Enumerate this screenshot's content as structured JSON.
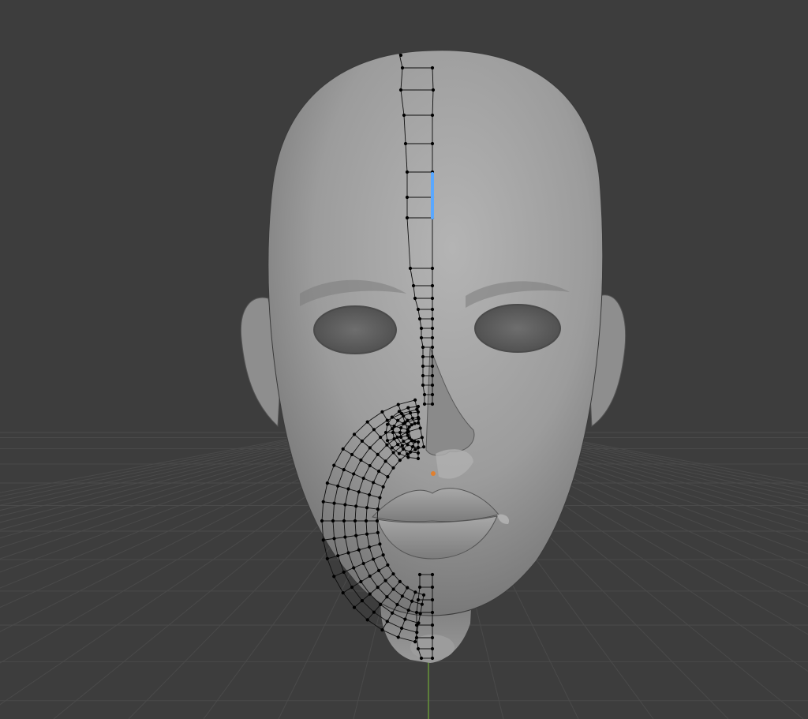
{
  "app": {
    "editor": "3d-viewport",
    "background_color": "#3d3d3d",
    "grid_line_color": "#4a4a4a",
    "y_axis_color": "#6a9a3a"
  },
  "scene": {
    "model": "head-sculpt",
    "mesh_color": "#9c9c9c",
    "wire_color": "#0d0d0d",
    "vertex_color": "#000000",
    "selected_edge_color": "#5aa8ff",
    "active_vertex_color": "#e08030",
    "retopology": "left-half"
  }
}
